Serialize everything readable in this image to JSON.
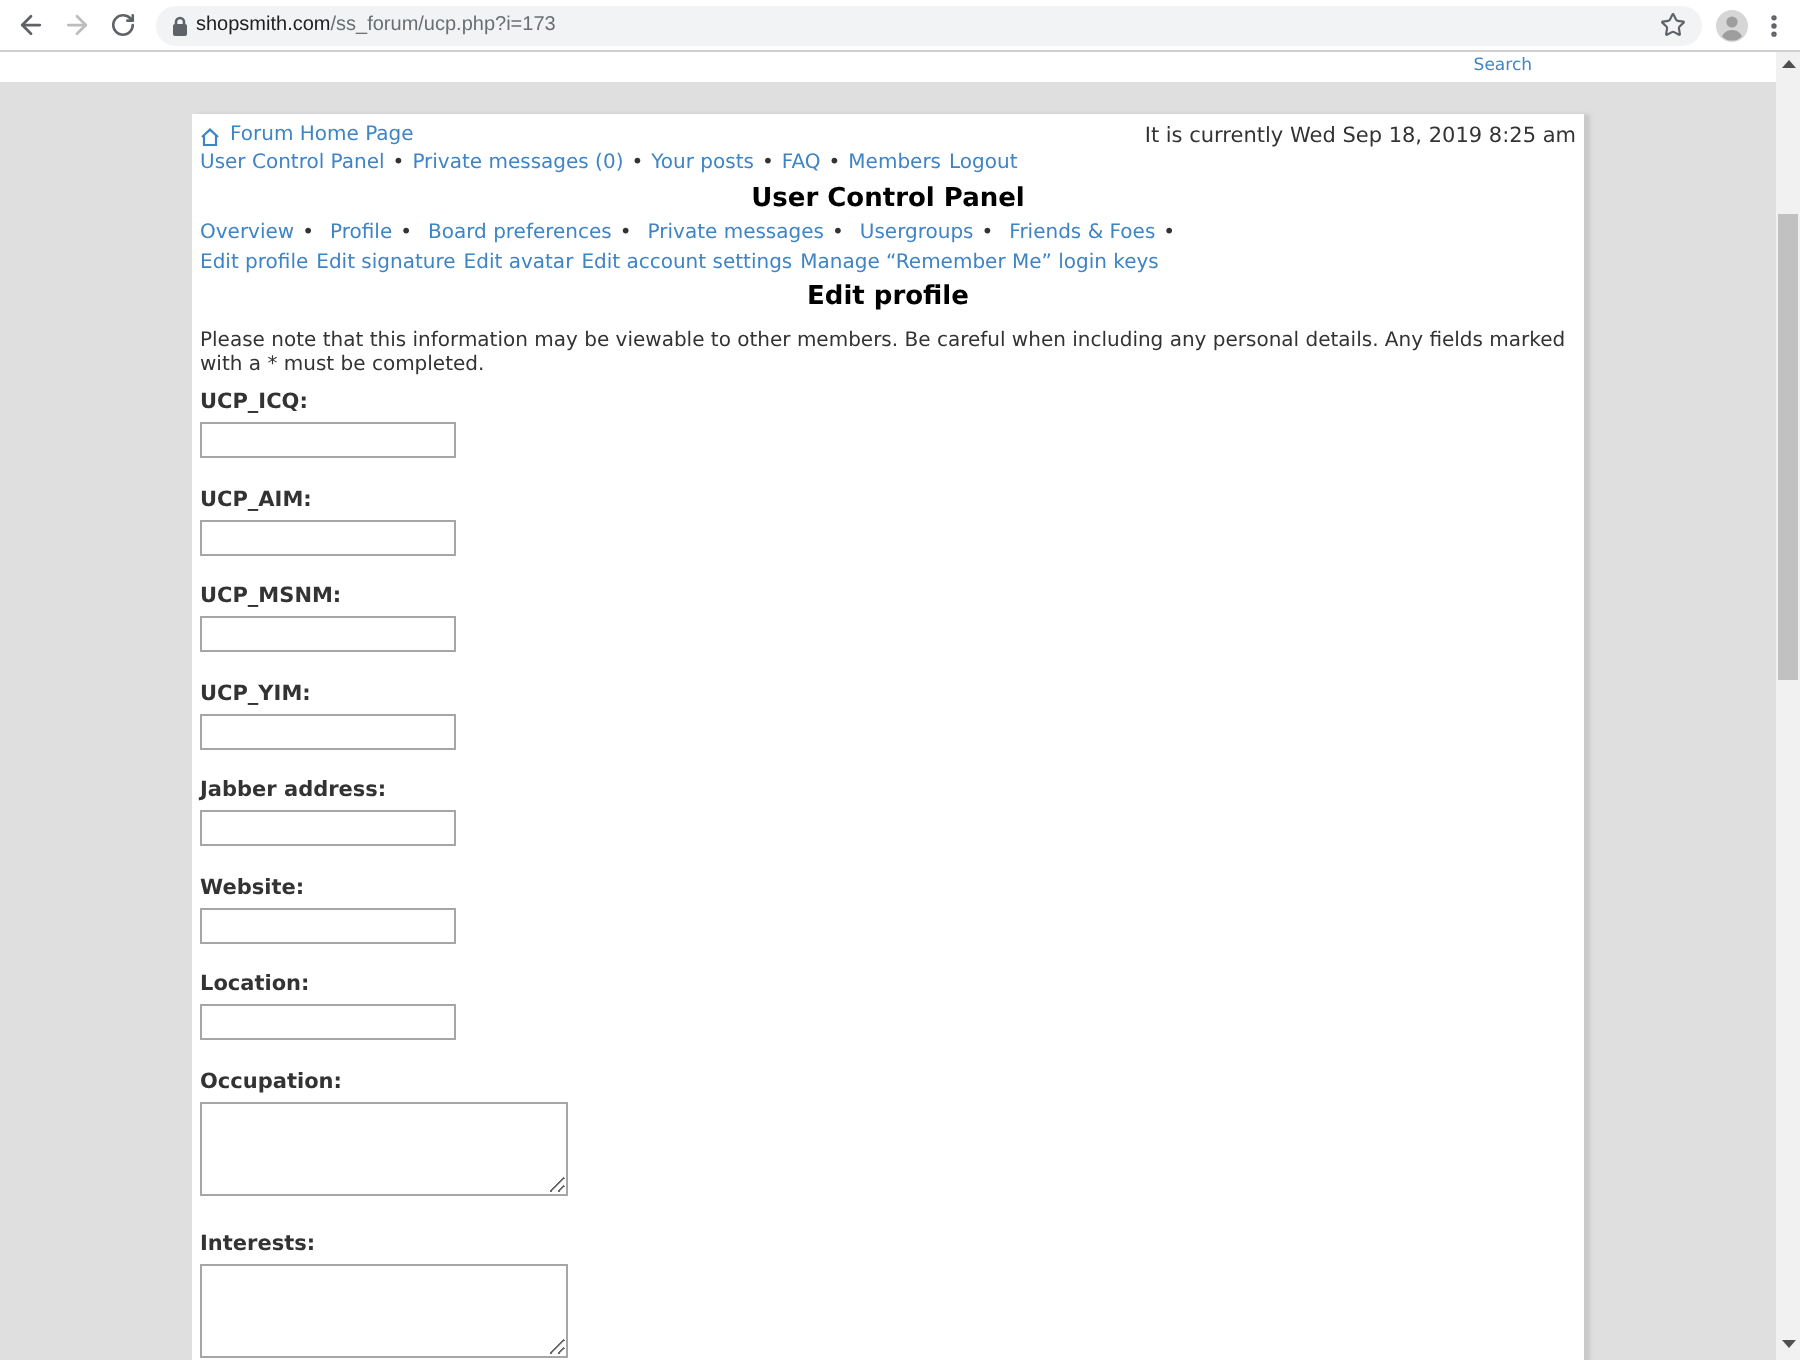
{
  "browser": {
    "back_button": {
      "disabled": false
    },
    "forward_button": {
      "disabled": true
    },
    "url": {
      "domain": "shopsmith.com",
      "path": "/ss_forum/ucp.php?i=173"
    }
  },
  "site_header": {
    "search_link": "Search"
  },
  "header": {
    "home_link": "Forum Home Page",
    "current_time": "It is currently Wed Sep 18, 2019 8:25 am"
  },
  "nav_links": [
    {
      "label": "User Control Panel"
    },
    {
      "label": "Private messages (0)",
      "separator": "•"
    },
    {
      "label": "Your posts",
      "separator": "•"
    },
    {
      "label": "FAQ",
      "separator": "•"
    },
    {
      "label": "Members",
      "separator": "•"
    },
    {
      "label": "Logout"
    }
  ],
  "panel_title": "User Control Panel",
  "tabs": [
    {
      "label": "Overview",
      "separator": "•"
    },
    {
      "label": "Profile",
      "separator": "•"
    },
    {
      "label": "Board preferences",
      "separator": "•"
    },
    {
      "label": "Private messages",
      "separator": "•"
    },
    {
      "label": "Usergroups",
      "separator": "•"
    },
    {
      "label": "Friends & Foes",
      "separator": "•"
    }
  ],
  "sub_tabs": [
    {
      "label": "Edit profile"
    },
    {
      "label": "Edit signature"
    },
    {
      "label": "Edit avatar"
    },
    {
      "label": "Edit account settings"
    },
    {
      "label": "Manage “Remember Me” login keys"
    }
  ],
  "form": {
    "title": "Edit profile",
    "notice": "Please note that this information may be viewable to other members. Be careful when including any personal details. Any fields marked with a * must be completed.",
    "fields": [
      {
        "kind": "input",
        "label": "UCP_ICQ:"
      },
      {
        "kind": "input",
        "label": "UCP_AIM:"
      },
      {
        "kind": "input",
        "label": "UCP_MSNM:"
      },
      {
        "kind": "input",
        "label": "UCP_YIM:"
      },
      {
        "kind": "input",
        "label": "Jabber address:"
      },
      {
        "kind": "input",
        "label": "Website:"
      },
      {
        "kind": "input",
        "label": "Location:"
      },
      {
        "kind": "textarea",
        "label": "Occupation:"
      },
      {
        "kind": "textarea",
        "label": "Interests:"
      }
    ]
  }
}
